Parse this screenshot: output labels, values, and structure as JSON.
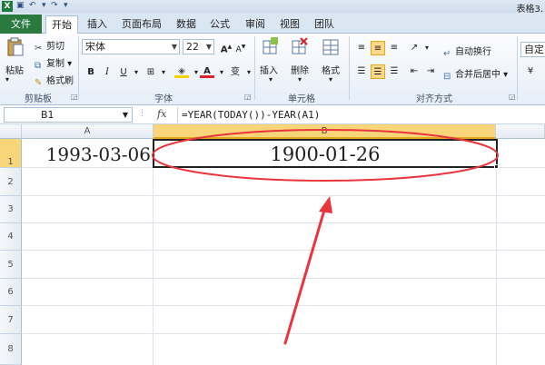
{
  "window": {
    "title": "表格3."
  },
  "tabs": [
    {
      "label": "文件"
    },
    {
      "label": "开始"
    },
    {
      "label": "插入"
    },
    {
      "label": "页面布局"
    },
    {
      "label": "数据"
    },
    {
      "label": "公式"
    },
    {
      "label": "审阅"
    },
    {
      "label": "视图"
    },
    {
      "label": "团队"
    }
  ],
  "ribbon": {
    "clipboard": {
      "paste": "粘贴",
      "cut": "剪切",
      "copy": "复制",
      "format_painter": "格式刷",
      "label": "剪贴板"
    },
    "font": {
      "name": "宋体",
      "size": "22",
      "bold": "B",
      "italic": "I",
      "underline": "U",
      "phonetic": "变",
      "label": "字体"
    },
    "cells": {
      "insert": "插入",
      "delete": "删除",
      "format": "格式",
      "label": "单元格"
    },
    "alignment": {
      "wrap": "自动换行",
      "merge": "合并后居中",
      "label": "对齐方式"
    },
    "number": {
      "format": "自定义"
    }
  },
  "formula_bar": {
    "name_box": "B1",
    "fx": "fx",
    "formula": "=YEAR(TODAY())-YEAR(A1)"
  },
  "sheet": {
    "columns": [
      "A",
      "B"
    ],
    "rows": [
      "1",
      "2",
      "3",
      "4",
      "5",
      "6",
      "7",
      "8"
    ],
    "cells": {
      "A1": "1993-03-06",
      "B1": "1900-01-26"
    }
  },
  "colors": {
    "annotation": "#e8343a",
    "selection_header": "#f9d57a",
    "file_tab": "#2a7a3f"
  }
}
